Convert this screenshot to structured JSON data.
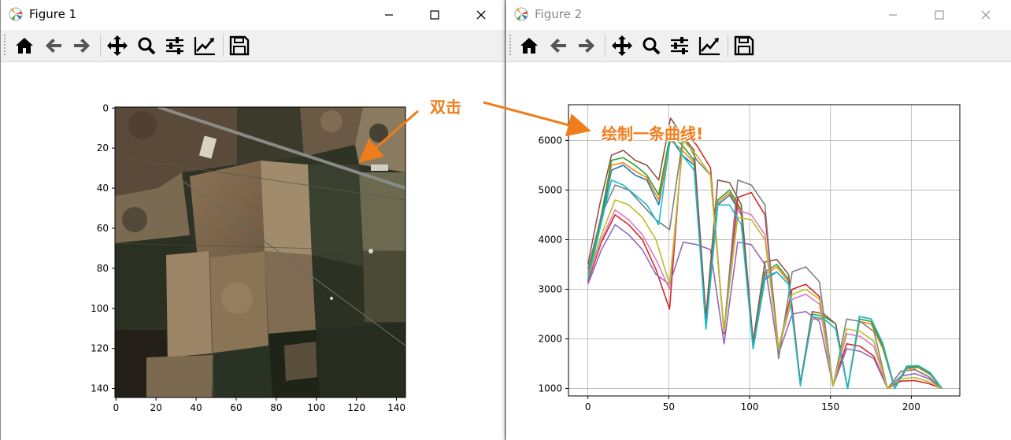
{
  "windows": [
    {
      "title": "Figure 1"
    },
    {
      "title": "Figure 2"
    }
  ],
  "toolbar_icons": [
    "home-icon",
    "back-arrow-icon",
    "forward-arrow-icon",
    "pan-move-icon",
    "zoom-magnifier-icon",
    "configure-subplots-icon",
    "edit-axes-icon",
    "save-icon"
  ],
  "annotations": {
    "double_click": "双击",
    "draw_curve": "绘制一条曲线!"
  },
  "colors": {
    "accent": "#f07d1c"
  },
  "chart_data": [
    {
      "type": "heatmap",
      "title": "",
      "xlim": [
        0,
        145
      ],
      "ylim": [
        145,
        0
      ],
      "xticks": [
        "0",
        "20",
        "40",
        "60",
        "80",
        "100",
        "120",
        "140"
      ],
      "yticks": [
        "0",
        "20",
        "40",
        "60",
        "80",
        "100",
        "120",
        "140"
      ],
      "content": "satellite RGB image"
    },
    {
      "type": "line",
      "title": "",
      "xlim": [
        -12,
        230
      ],
      "ylim": [
        850,
        6720
      ],
      "xticks": [
        "0",
        "50",
        "100",
        "150",
        "200"
      ],
      "yticks": [
        "1000",
        "2000",
        "3000",
        "4000",
        "5000",
        "6000"
      ],
      "grid": true,
      "x_range": [
        0,
        219
      ],
      "series": [
        {
          "color": "#1f77b4",
          "values": [
            3200,
            4200,
            5400,
            5500,
            5300,
            5200,
            4700,
            6050,
            5700,
            5500,
            2200,
            4700,
            4900,
            4500,
            1800,
            3200,
            3350,
            3100,
            1100,
            2400,
            2400,
            2200,
            1000,
            2350,
            2300,
            1800,
            1000,
            1400,
            1420,
            1280,
            1000
          ]
        },
        {
          "color": "#ff7f0e",
          "values": [
            3300,
            4350,
            5500,
            5550,
            5380,
            5250,
            4800,
            6000,
            5800,
            5550,
            2300,
            4750,
            4950,
            4550,
            1850,
            3300,
            3450,
            3150,
            1100,
            2400,
            2400,
            2200,
            1000,
            2350,
            2300,
            1800,
            1000,
            1400,
            1420,
            1280,
            1000
          ]
        },
        {
          "color": "#2ca02c",
          "values": [
            3250,
            4300,
            5600,
            5650,
            5500,
            5300,
            4900,
            6150,
            5900,
            5600,
            2300,
            4800,
            5000,
            4600,
            1850,
            3350,
            3500,
            3200,
            1100,
            2500,
            2450,
            2300,
            1000,
            2400,
            2350,
            1850,
            1000,
            1420,
            1440,
            1300,
            1000
          ]
        },
        {
          "color": "#d62728",
          "values": [
            3150,
            3950,
            4500,
            4300,
            4000,
            3400,
            2600,
            6200,
            5900,
            5450,
            2100,
            4850,
            4950,
            4500,
            1800,
            3000,
            3100,
            2850,
            1050,
            1900,
            1850,
            1650,
            1000,
            1150,
            1160,
            1100,
            1000
          ]
        },
        {
          "color": "#9467bd",
          "values": [
            3100,
            3800,
            4300,
            4100,
            3800,
            3300,
            3100,
            3950,
            3900,
            3800,
            1900,
            3950,
            3900,
            3500,
            1700,
            2500,
            2550,
            2350,
            1050,
            1800,
            1750,
            1600,
            1000,
            1250,
            1300,
            1200,
            1000
          ]
        },
        {
          "color": "#8c564b",
          "values": [
            3500,
            4700,
            5700,
            5800,
            5600,
            5500,
            5200,
            6450,
            6100,
            5800,
            2450,
            5200,
            5150,
            4700,
            1950,
            3550,
            3600,
            3300,
            1100,
            2550,
            2500,
            2300,
            1000,
            2450,
            2400,
            1900,
            1000,
            1450,
            1460,
            1320,
            1000
          ]
        },
        {
          "color": "#e377c2",
          "values": [
            3200,
            4000,
            4600,
            4400,
            4100,
            3600,
            3000,
            6000,
            5700,
            5300,
            2150,
            4600,
            4500,
            4100,
            1800,
            2800,
            2900,
            2700,
            1050,
            2100,
            2050,
            1850,
            1000,
            1350,
            1380,
            1240,
            1000
          ]
        },
        {
          "color": "#7f7f7f",
          "values": [
            3400,
            4500,
            5100,
            5000,
            4700,
            4400,
            4200,
            6100,
            5600,
            5300,
            2150,
            5200,
            5100,
            4700,
            1600,
            3350,
            3450,
            3150,
            1050,
            2400,
            2350,
            2150,
            1000,
            1350,
            1380,
            1240,
            1000
          ]
        },
        {
          "color": "#bcbd22",
          "values": [
            3250,
            4100,
            4800,
            4700,
            4450,
            4000,
            3100,
            6000,
            5700,
            5300,
            2150,
            4450,
            4400,
            4000,
            1800,
            2900,
            3000,
            2800,
            1050,
            2200,
            2150,
            1950,
            1000,
            1200,
            1220,
            1140,
            1000
          ]
        },
        {
          "color": "#17becf",
          "values": [
            3200,
            4200,
            5200,
            5100,
            4900,
            4700,
            4300,
            6100,
            5700,
            5400,
            2200,
            4700,
            4700,
            4300,
            1800,
            3250,
            3350,
            3100,
            1050,
            2450,
            2400,
            2200,
            1000,
            2450,
            2400,
            1900,
            1000,
            1450,
            1460,
            1320,
            1000
          ]
        }
      ]
    }
  ]
}
